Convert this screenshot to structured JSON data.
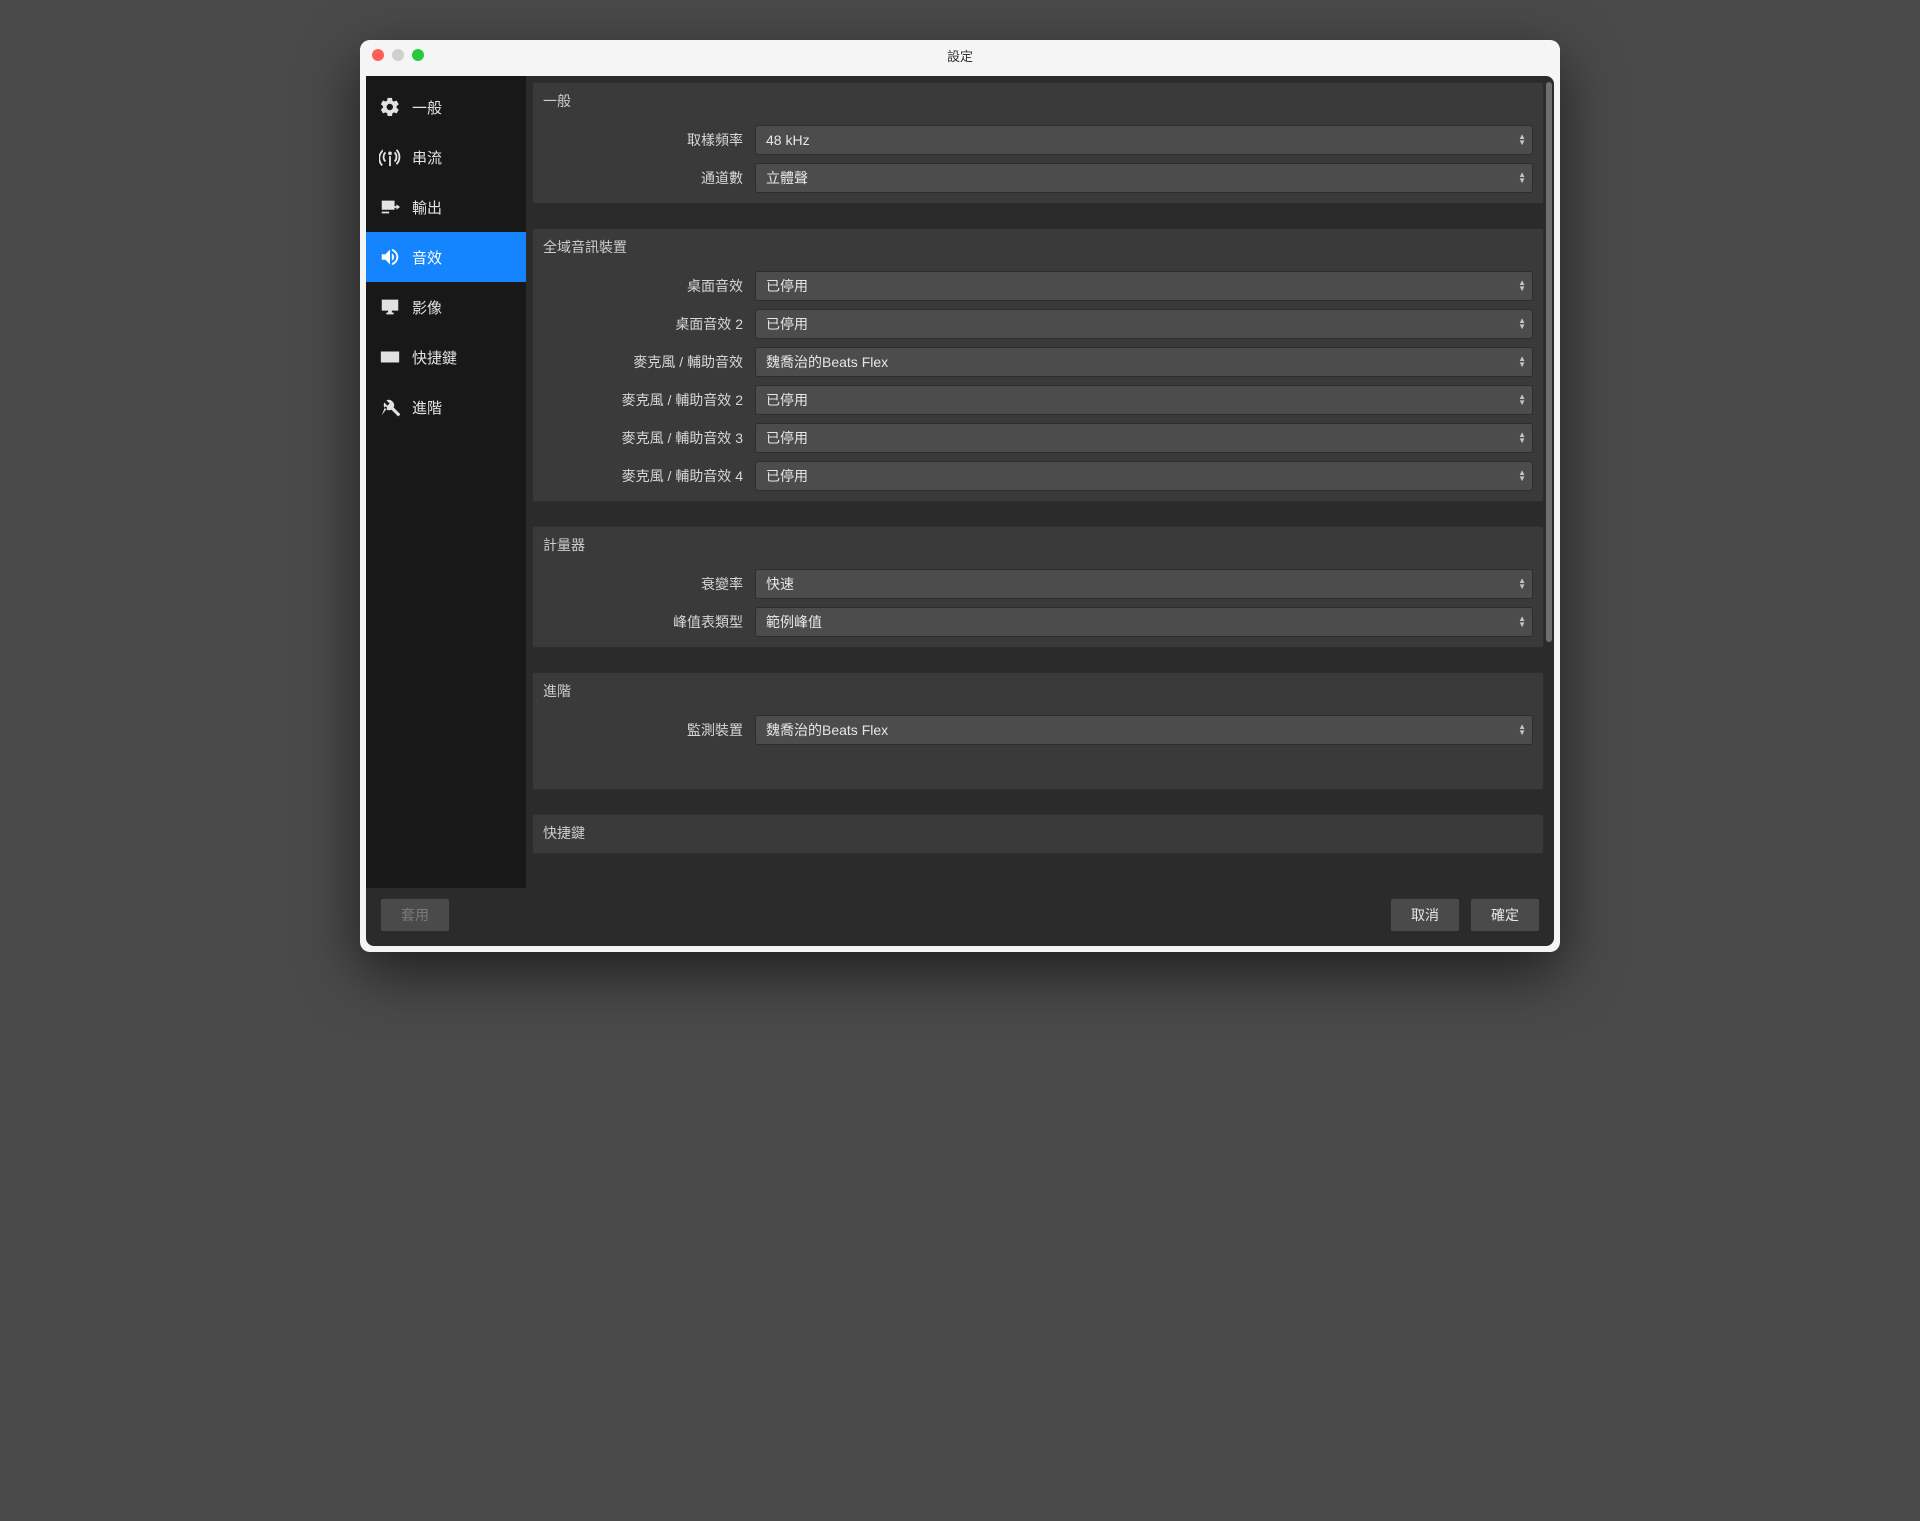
{
  "window": {
    "title": "設定"
  },
  "sidebar": {
    "items": [
      {
        "id": "general",
        "label": "一般"
      },
      {
        "id": "stream",
        "label": "串流"
      },
      {
        "id": "output",
        "label": "輸出"
      },
      {
        "id": "audio",
        "label": "音效"
      },
      {
        "id": "video",
        "label": "影像"
      },
      {
        "id": "hotkeys",
        "label": "快捷鍵"
      },
      {
        "id": "advanced",
        "label": "進階"
      }
    ],
    "active_id": "audio"
  },
  "sections": {
    "general": {
      "title": "一般",
      "sample_rate": {
        "label": "取樣頻率",
        "value": "48 kHz"
      },
      "channels": {
        "label": "通道數",
        "value": "立體聲"
      }
    },
    "devices": {
      "title": "全域音訊裝置",
      "desktop1": {
        "label": "桌面音效",
        "value": "已停用"
      },
      "desktop2": {
        "label": "桌面音效 2",
        "value": "已停用"
      },
      "mic1": {
        "label": "麥克風 / 輔助音效",
        "value": "魏喬治的Beats Flex"
      },
      "mic2": {
        "label": "麥克風 / 輔助音效 2",
        "value": "已停用"
      },
      "mic3": {
        "label": "麥克風 / 輔助音效 3",
        "value": "已停用"
      },
      "mic4": {
        "label": "麥克風 / 輔助音效 4",
        "value": "已停用"
      }
    },
    "meters": {
      "title": "計量器",
      "decay": {
        "label": "衰變率",
        "value": "快速"
      },
      "peak_type": {
        "label": "峰值表類型",
        "value": "範例峰值"
      }
    },
    "advanced": {
      "title": "進階",
      "monitor": {
        "label": "監測裝置",
        "value": "魏喬治的Beats Flex"
      }
    },
    "hotkeys": {
      "title": "快捷鍵"
    }
  },
  "buttons": {
    "apply": "套用",
    "cancel": "取消",
    "ok": "確定"
  }
}
